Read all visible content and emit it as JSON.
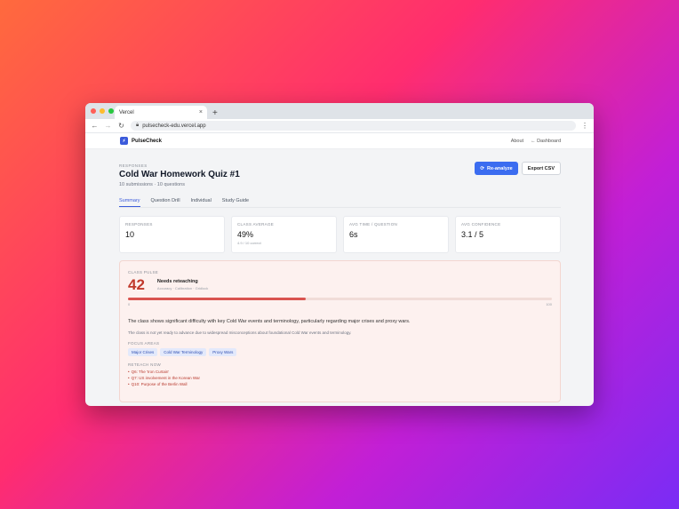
{
  "browser": {
    "tab_title": "Vercel",
    "tab_close": "×",
    "new_tab": "+",
    "url": "pulsecheck-edu.vercel.app",
    "dot_colors": [
      "#ff5f57",
      "#febc2e",
      "#28c840"
    ]
  },
  "header": {
    "brand": "PulseCheck",
    "links": [
      "About",
      "← Dashboard"
    ]
  },
  "page": {
    "eyebrow": "RESPONSES",
    "title": "Cold War Homework Quiz #1",
    "subtitle": "10 submissions · 10 questions",
    "reanalyze_label": "Re-analyze",
    "export_label": "Export CSV"
  },
  "tabs": [
    "Summary",
    "Question Drill",
    "Individual",
    "Study Guide"
  ],
  "stats": [
    {
      "label": "RESPONSES",
      "value": "10",
      "sub": ""
    },
    {
      "label": "CLASS AVERAGE",
      "value": "49%",
      "sub": "4.9 / 10 correct"
    },
    {
      "label": "AVG TIME / QUESTION",
      "value": "6s",
      "sub": ""
    },
    {
      "label": "AVG CONFIDENCE",
      "value": "3.1 / 5",
      "sub": ""
    }
  ],
  "pulse": {
    "label": "CLASS PULSE",
    "score": "42",
    "score_fraction": 0.42,
    "verdict": "Needs reteaching",
    "verdict_sub": "Accuracy · Calibration · Gridlock",
    "tick_min": "0",
    "tick_max": "100",
    "summary": "The class shows significant difficulty with key Cold War events and terminology, particularly regarding major crises and proxy wars.",
    "note": "The class is not yet ready to advance due to widespread misconceptions about foundational Cold War events and terminology.",
    "focus_label": "FOCUS AREAS",
    "focus_areas": [
      "Major Crises",
      "Cold War Terminology",
      "Proxy Wars"
    ],
    "reteach_label": "RETEACH NOW",
    "reteach": [
      "Q6: The 'Iron Curtain'",
      "Q7: US involvement in the Korean War",
      "Q10: Purpose of the Berlin Wall"
    ]
  }
}
